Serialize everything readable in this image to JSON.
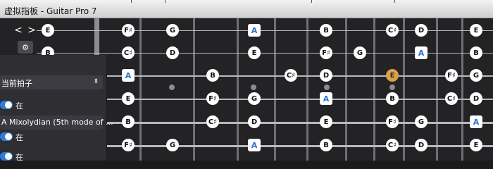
{
  "window": {
    "title": "虚拟指板 - Guitar Pro 7"
  },
  "nav": {
    "prev_label": "<",
    "next_label": ">",
    "settings_icon": "gear-icon"
  },
  "panel": {
    "rhythm_select": "当前拍子",
    "toggle1_label": "在",
    "scale_select": "A Mixolydian (5th mode of ...",
    "toggle2_label": "在",
    "toggle3_label": "在"
  },
  "colors": {
    "accent": "#2e7dd8",
    "root_note": "#2f6fd1",
    "highlight": "#d9a24a"
  },
  "fretboard": {
    "open_notes": [
      "E",
      "B",
      "",
      "",
      "",
      ""
    ],
    "rows": [
      {
        "notes": [
          "F♯",
          "G",
          "",
          "A",
          "",
          "B",
          "",
          "C♯",
          "D",
          "",
          "E"
        ]
      },
      {
        "notes": [
          "C♯",
          "D",
          "",
          "E",
          "",
          "F♯",
          "G",
          "",
          "A",
          "",
          "B"
        ]
      },
      {
        "notes": [
          "A",
          "",
          "B",
          "",
          "C♯",
          "D",
          "",
          "E",
          "",
          "F♯",
          "G"
        ]
      },
      {
        "notes": [
          "E",
          "",
          "F♯",
          "G",
          "",
          "A",
          "",
          "B",
          "",
          "C♯",
          "D"
        ]
      },
      {
        "notes": [
          "B",
          "",
          "C♯",
          "D",
          "",
          "E",
          "",
          "F♯",
          "G",
          "",
          "A"
        ]
      },
      {
        "notes": [
          "F♯",
          "G",
          "",
          "A",
          "",
          "B",
          "",
          "C♯",
          "D",
          "",
          "E"
        ]
      }
    ],
    "root": "A",
    "highlighted": "E",
    "inlays": [
      "3",
      "5",
      "7",
      "9"
    ]
  }
}
